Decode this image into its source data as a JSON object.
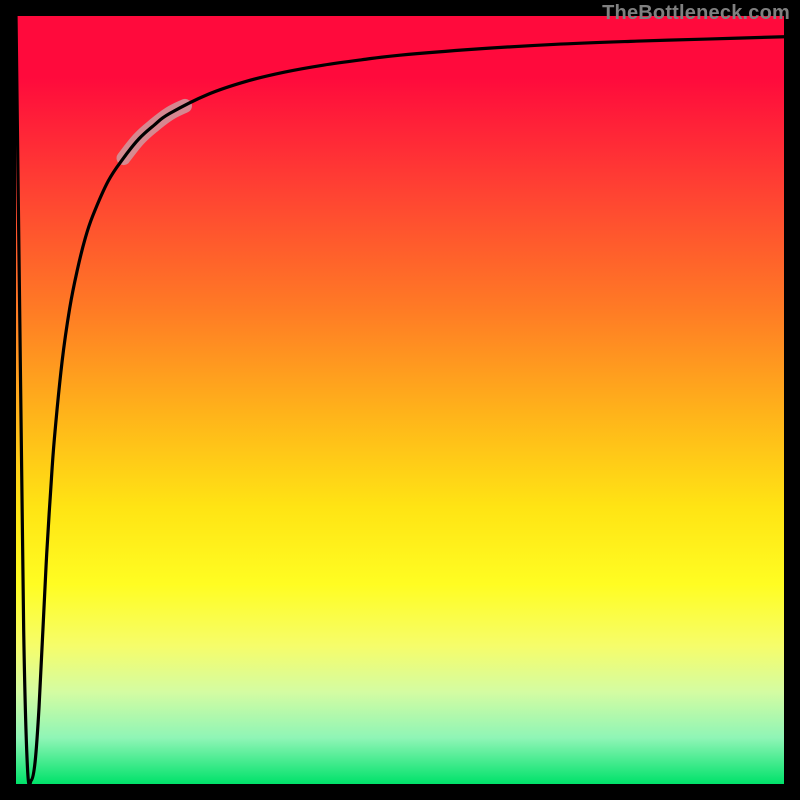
{
  "attribution": "TheBottleneck.com",
  "chart_data": {
    "type": "line",
    "title": "",
    "xlabel": "",
    "ylabel": "",
    "xlim": [
      0,
      100
    ],
    "ylim": [
      0,
      100
    ],
    "grid": false,
    "legend": false,
    "series": [
      {
        "name": "bottleneck-curve",
        "x": [
          0.0,
          0.5,
          1.0,
          1.5,
          2.0,
          2.5,
          3.0,
          3.5,
          4.0,
          4.5,
          5.0,
          6.0,
          7.0,
          8.0,
          9.0,
          10.0,
          12.0,
          14.0,
          16.0,
          18.0,
          20.0,
          25.0,
          30.0,
          35.0,
          40.0,
          45.0,
          50.0,
          60.0,
          70.0,
          80.0,
          90.0,
          100.0
        ],
        "y": [
          100.0,
          60.0,
          20.0,
          2.0,
          0.5,
          3.0,
          10.0,
          20.0,
          30.0,
          38.0,
          45.0,
          55.0,
          62.0,
          67.0,
          71.0,
          74.0,
          78.5,
          81.5,
          84.0,
          85.8,
          87.3,
          89.8,
          91.5,
          92.7,
          93.6,
          94.3,
          94.9,
          95.7,
          96.3,
          96.7,
          97.0,
          97.3
        ]
      }
    ],
    "highlight": {
      "name": "highlight-segment",
      "x_range": [
        14.0,
        22.0
      ],
      "note": "thick pale overlay along curve"
    },
    "colors": {
      "curve": "#000000",
      "highlight": "#cf9aa0",
      "gradient_top": "#ff0a3c",
      "gradient_bottom": "#00e26a"
    }
  }
}
